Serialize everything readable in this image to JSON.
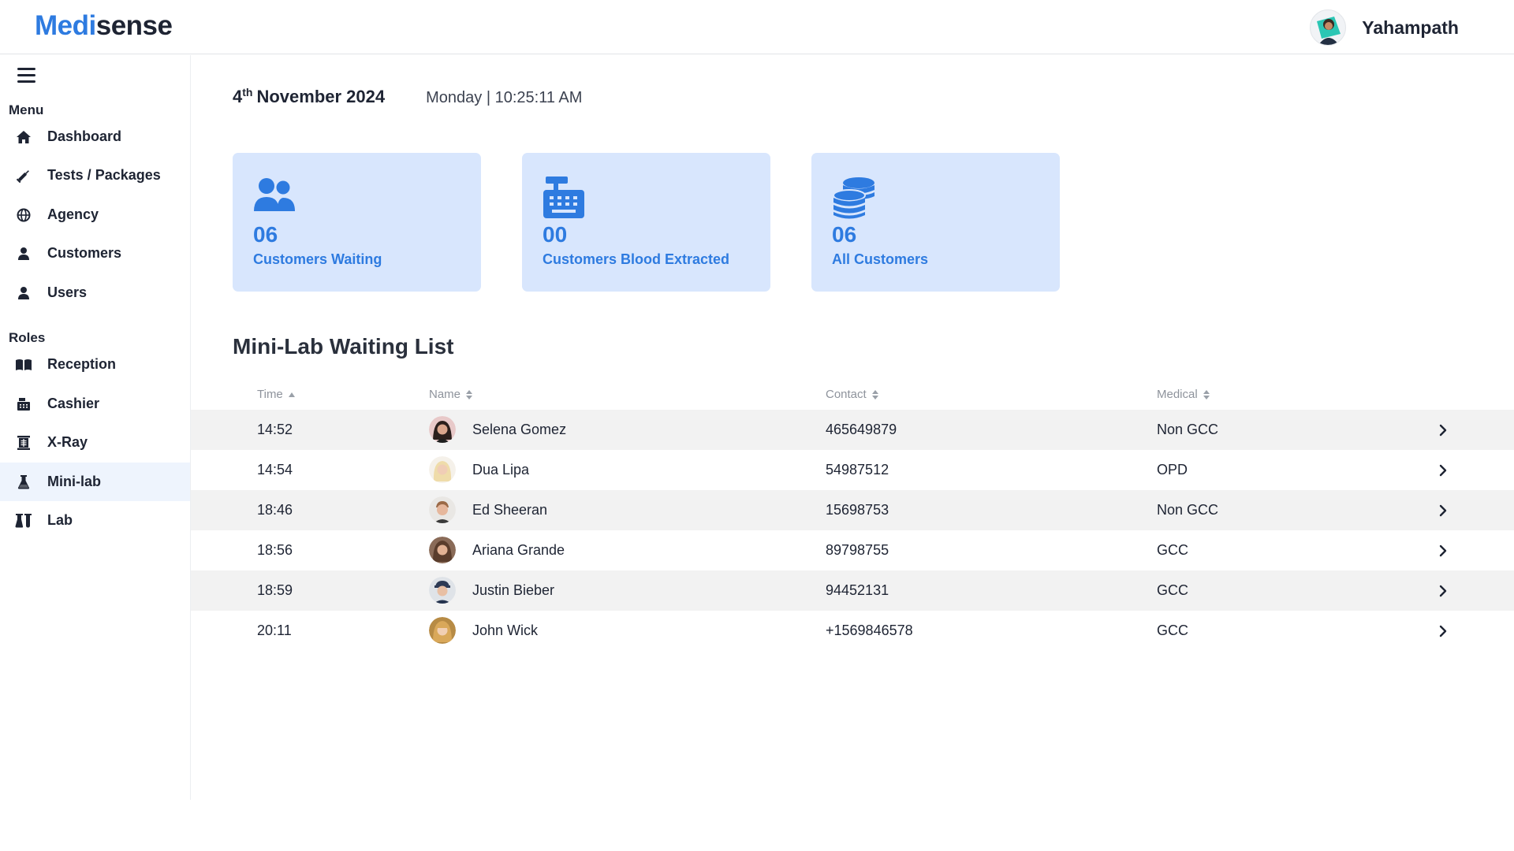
{
  "brand": {
    "part1": "Medi",
    "part2": "sense",
    "color_primary": "#2e7be0",
    "color_dark": "#1e2433"
  },
  "user": {
    "name": "Yahampath",
    "avatar_icon": "user-avatar"
  },
  "sidebar": {
    "menu_heading": "Menu",
    "menu_items": [
      {
        "label": "Dashboard",
        "icon": "home-icon"
      },
      {
        "label": "Tests / Packages",
        "icon": "syringe-icon"
      },
      {
        "label": "Agency",
        "icon": "globe-icon"
      },
      {
        "label": "Customers",
        "icon": "user-icon"
      },
      {
        "label": "Users",
        "icon": "user-icon"
      }
    ],
    "roles_heading": "Roles",
    "role_items": [
      {
        "label": "Reception",
        "icon": "book-icon"
      },
      {
        "label": "Cashier",
        "icon": "cash-register-icon"
      },
      {
        "label": "X-Ray",
        "icon": "x-ray-icon"
      },
      {
        "label": "Mini-lab",
        "icon": "flask-icon",
        "active": true
      },
      {
        "label": "Lab",
        "icon": "flask-vial-icon"
      }
    ]
  },
  "datetime": {
    "day": "4",
    "suffix": "th",
    "month_year": "November 2024",
    "time": "Monday | 10:25:11 AM"
  },
  "cards": [
    {
      "value": "06",
      "label": "Customers Waiting",
      "icon": "users-icon"
    },
    {
      "value": "00",
      "label": "Customers Blood Extracted",
      "icon": "cash-register-icon"
    },
    {
      "value": "06",
      "label": "All Customers",
      "icon": "coins-stack-icon"
    }
  ],
  "list": {
    "title": "Mini-Lab Waiting List",
    "headers": {
      "time": "Time",
      "name": "Name",
      "contact": "Contact",
      "medical": "Medical"
    },
    "rows": [
      {
        "time": "14:52",
        "name": "Selena Gomez",
        "contact": "465649879",
        "medical": "Non GCC"
      },
      {
        "time": "14:54",
        "name": "Dua Lipa",
        "contact": "54987512",
        "medical": "OPD"
      },
      {
        "time": "18:46",
        "name": "Ed Sheeran",
        "contact": "15698753",
        "medical": "Non GCC"
      },
      {
        "time": "18:56",
        "name": "Ariana Grande",
        "contact": "89798755",
        "medical": "GCC"
      },
      {
        "time": "18:59",
        "name": "Justin Bieber",
        "contact": "94452131",
        "medical": "GCC"
      },
      {
        "time": "20:11",
        "name": "John Wick",
        "contact": "+1569846578",
        "medical": "GCC"
      }
    ]
  }
}
